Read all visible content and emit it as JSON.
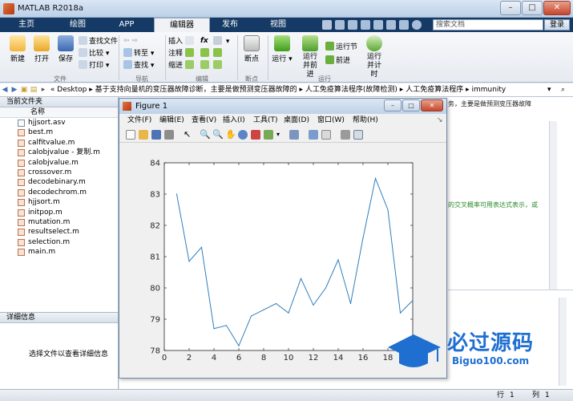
{
  "window": {
    "title": "MATLAB R2018a"
  },
  "tabs": [
    "主页",
    "绘图",
    "APP",
    "编辑器",
    "发布",
    "视图"
  ],
  "active_tab": "编辑器",
  "search": {
    "placeholder": "搜索文档",
    "button": "登录"
  },
  "ribbon": {
    "new": "新建",
    "open": "打开",
    "save": "保存",
    "find_files": "查找文件",
    "compare": "比较",
    "print": "打印",
    "goto": "转至",
    "find": "查找",
    "insert": "插入",
    "fx": "fx",
    "comment": "注释",
    "indent": "缩进",
    "breakpoints": "断点",
    "run": "运行",
    "run_advance": "运行并前进",
    "run_section": "运行节",
    "advance": "前进",
    "run_time": "运行并计时",
    "sections": [
      "文件",
      "导航",
      "编辑",
      "断点",
      "运行"
    ]
  },
  "address": {
    "path": [
      "Desktop",
      "基于支持向量机的变压器故障诊断，主要是做预测变压器故障的",
      "人工免疫算法程序(故障检测)",
      "人工免疫算法程序",
      "immunity"
    ]
  },
  "current_folder": {
    "title": "当前文件夹",
    "column": "名称",
    "files": [
      "hjjsort.asv",
      "best.m",
      "calfitvalue.m",
      "calobjvalue - 复制.m",
      "calobjvalue.m",
      "crossover.m",
      "decodebinary.m",
      "decodechrom.m",
      "hjjsort.m",
      "initpop.m",
      "mutation.m",
      "resultselect.m",
      "selection.m",
      "main.m"
    ]
  },
  "details": {
    "title": "详细信息",
    "message": "选择文件以查看详细信息"
  },
  "editor_hints": {
    "line1": "务，主要是做预测变压器故障",
    "line2": "的交叉概率可用表达式表示，或"
  },
  "status": {
    "row_label": "行",
    "row": "1",
    "col_label": "列",
    "col": "1"
  },
  "figure": {
    "title": "Figure 1",
    "menu": [
      "文件(F)",
      "编辑(E)",
      "查看(V)",
      "插入(I)",
      "工具(T)",
      "桌面(D)",
      "窗口(W)",
      "帮助(H)"
    ]
  },
  "watermark": {
    "text": "必过源码",
    "url": "Biguo100.com"
  },
  "chart_data": {
    "type": "line",
    "x": [
      1,
      2,
      3,
      4,
      5,
      6,
      7,
      8,
      9,
      10,
      11,
      12,
      13,
      14,
      15,
      16,
      17,
      18,
      19,
      20
    ],
    "series": [
      {
        "values": [
          83.0,
          80.85,
          81.3,
          78.7,
          78.8,
          78.15,
          79.1,
          79.3,
          79.5,
          79.2,
          80.3,
          79.45,
          80.0,
          80.9,
          79.5,
          81.6,
          83.5,
          82.5,
          79.2,
          79.6
        ],
        "color": "#2f7fbf"
      }
    ],
    "xlim": [
      0,
      20
    ],
    "ylim": [
      78,
      84
    ],
    "xticks": [
      0,
      2,
      4,
      6,
      8,
      10,
      12,
      14,
      16,
      18
    ],
    "yticks": [
      78,
      79,
      80,
      81,
      82,
      83,
      84
    ],
    "title": "",
    "xlabel": "",
    "ylabel": "",
    "grid": false
  }
}
